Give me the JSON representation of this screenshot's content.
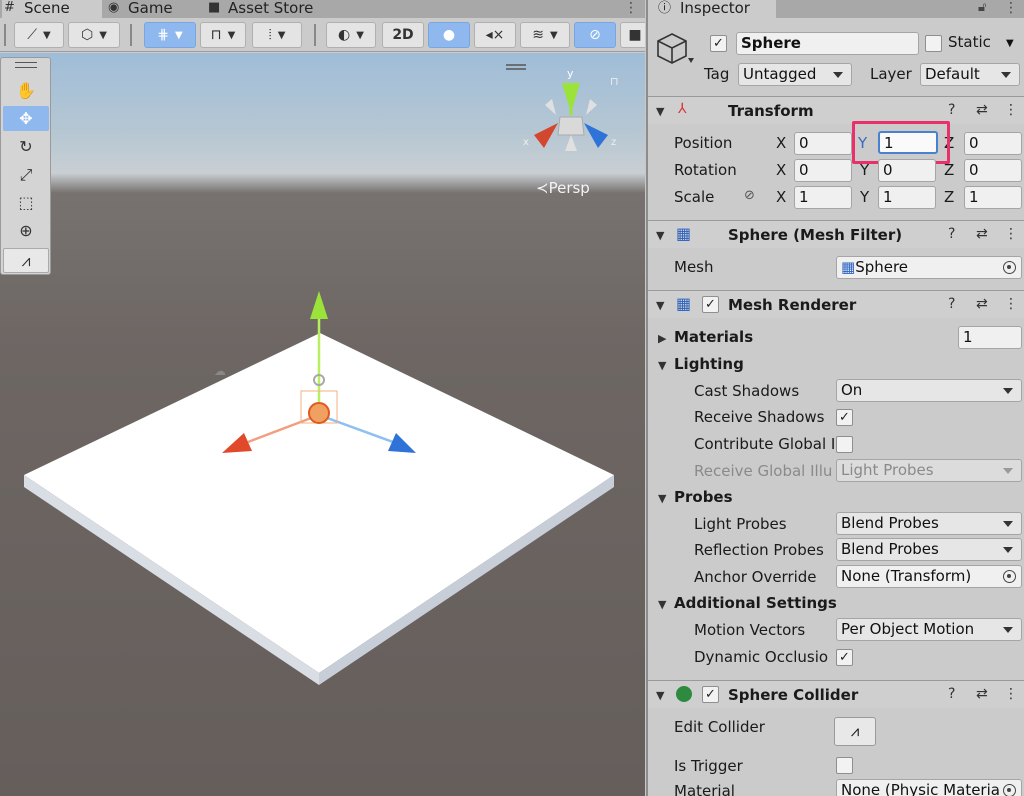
{
  "scene": {
    "tabs": [
      {
        "label": "Scene",
        "icon": "grid-icon"
      },
      {
        "label": "Game",
        "icon": "gamepad-icon"
      },
      {
        "label": "Asset Store",
        "icon": "bag-icon"
      }
    ],
    "toolbar": {
      "mode_2d": "2D"
    },
    "viewport": {
      "projection_label": "Persp",
      "gizmo_y": "y",
      "gizmo_x": "x",
      "gizmo_z": "z"
    },
    "tools": [
      "hand-icon",
      "move-icon",
      "rotate-icon",
      "scale-icon",
      "rect-icon",
      "transform-icon",
      "custom-tool-icon"
    ]
  },
  "inspector": {
    "tab_label": "Inspector",
    "object": {
      "name": "Sphere",
      "active": true,
      "static_label": "Static",
      "static_checked": false,
      "tag_label": "Tag",
      "tag_value": "Untagged",
      "layer_label": "Layer",
      "layer_value": "Default"
    },
    "transform": {
      "title": "Transform",
      "position_label": "Position",
      "rotation_label": "Rotation",
      "scale_label": "Scale",
      "axis_x": "X",
      "axis_y": "Y",
      "axis_z": "Z",
      "position": {
        "x": "0",
        "y": "1",
        "z": "0"
      },
      "rotation": {
        "x": "0",
        "y": "0",
        "z": "0"
      },
      "scale": {
        "x": "1",
        "y": "1",
        "z": "1"
      }
    },
    "mesh_filter": {
      "title": "Sphere (Mesh Filter)",
      "mesh_label": "Mesh",
      "mesh_value": "Sphere"
    },
    "mesh_renderer": {
      "title": "Mesh Renderer",
      "enabled": true,
      "materials_label": "Materials",
      "materials_count": "1",
      "lighting_label": "Lighting",
      "cast_shadows_label": "Cast Shadows",
      "cast_shadows_value": "On",
      "receive_shadows_label": "Receive Shadows",
      "receive_shadows_checked": true,
      "contribute_gi_label": "Contribute Global I",
      "contribute_gi_checked": false,
      "receive_gi_label": "Receive Global Illu",
      "receive_gi_value": "Light Probes",
      "probes_label": "Probes",
      "light_probes_label": "Light Probes",
      "light_probes_value": "Blend Probes",
      "reflection_probes_label": "Reflection Probes",
      "reflection_probes_value": "Blend Probes",
      "anchor_override_label": "Anchor Override",
      "anchor_override_value": "None (Transform)",
      "additional_label": "Additional Settings",
      "motion_vectors_label": "Motion Vectors",
      "motion_vectors_value": "Per Object Motion",
      "dynamic_occlusion_label": "Dynamic Occlusio",
      "dynamic_occlusion_checked": true
    },
    "sphere_collider": {
      "title": "Sphere Collider",
      "enabled": true,
      "edit_collider_label": "Edit Collider",
      "is_trigger_label": "Is Trigger",
      "is_trigger_checked": false,
      "material_label": "Material",
      "material_value": "None (Physic Materia"
    }
  },
  "colors": {
    "highlight_box": "#e8306a",
    "selected_tool": "#8fb8ef",
    "gizmo_y": "#9be23a",
    "gizmo_x": "#e04a2a",
    "gizmo_z": "#2f72d8"
  }
}
